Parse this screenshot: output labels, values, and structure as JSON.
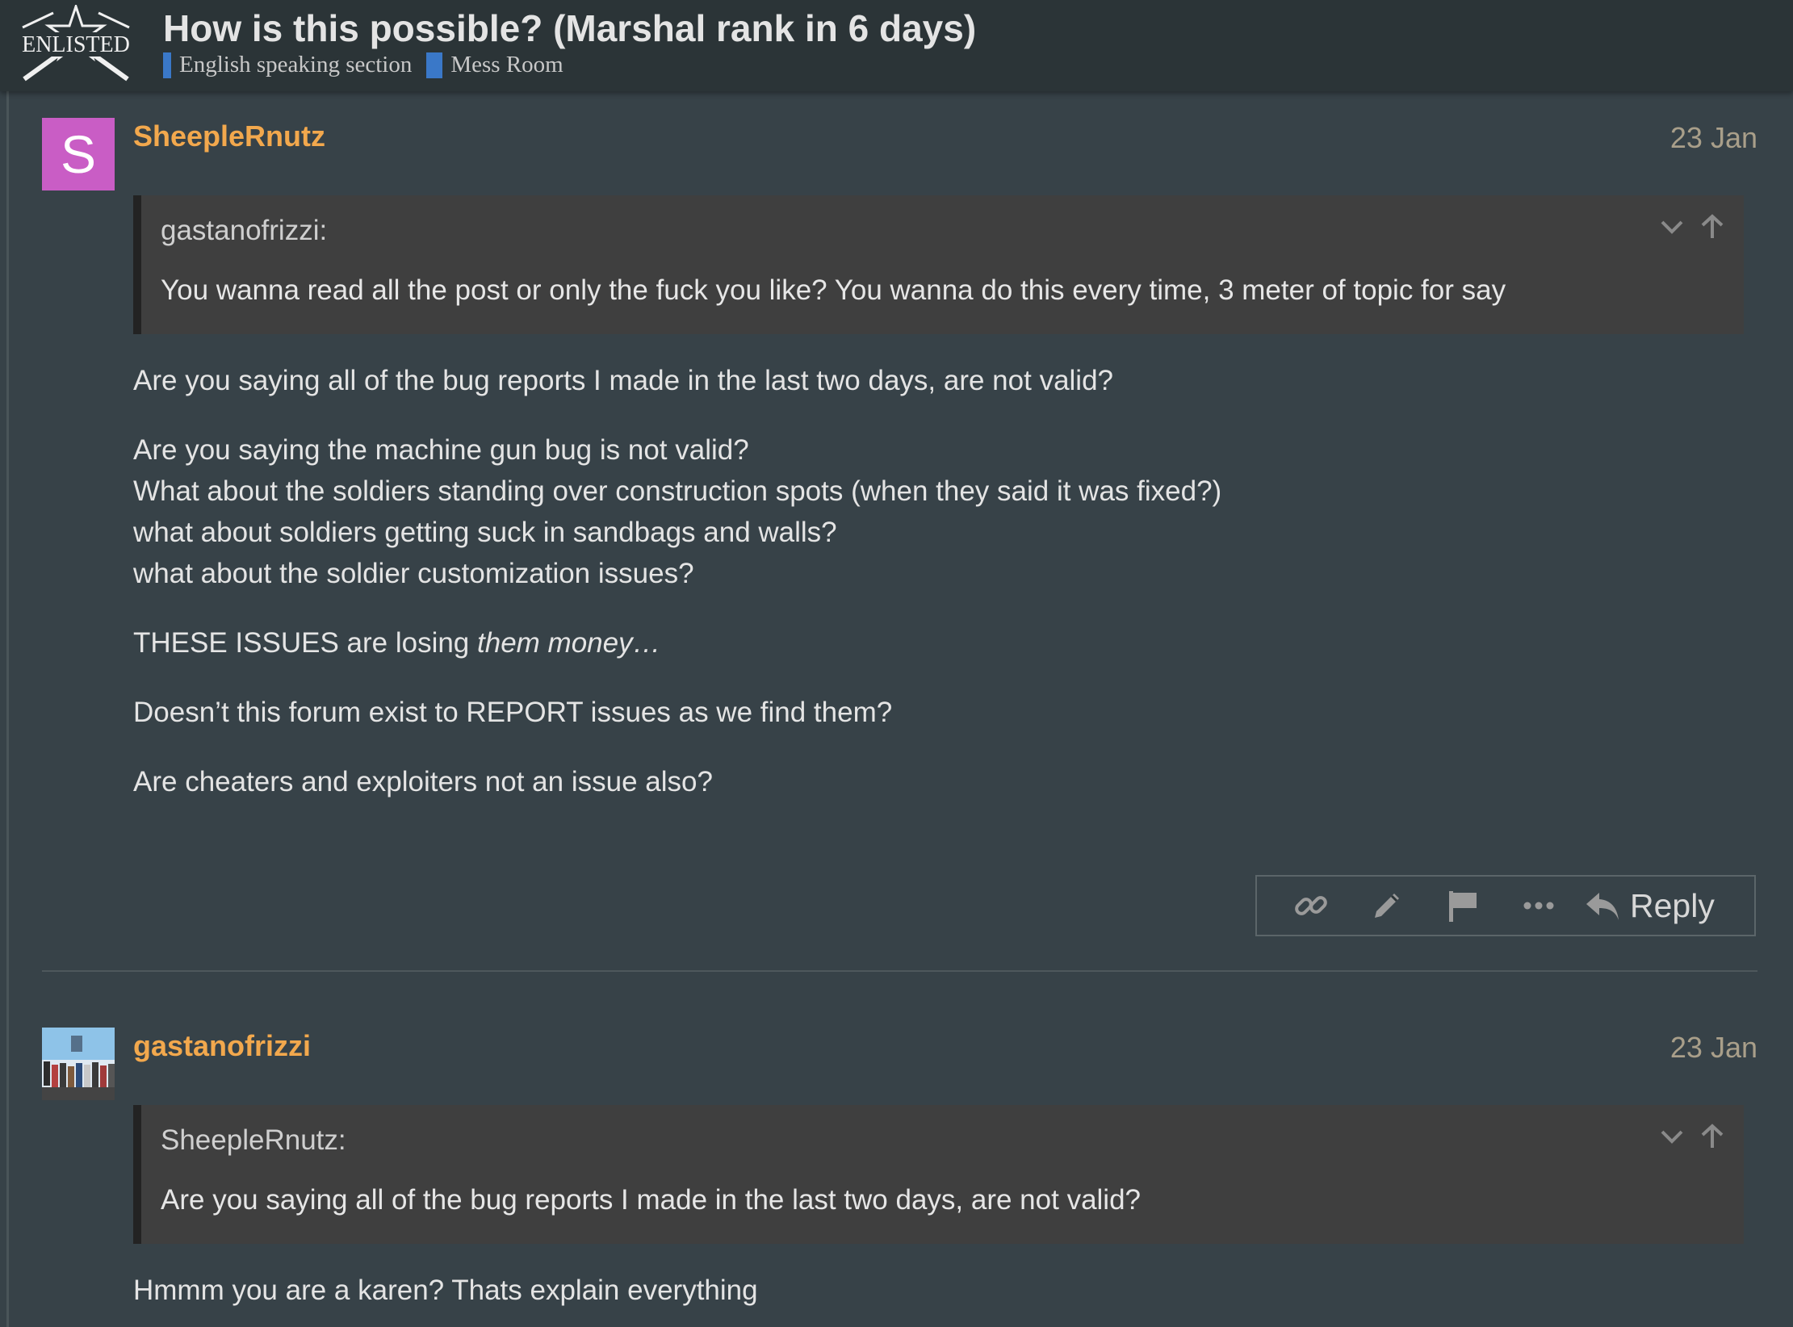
{
  "site": {
    "logo_text": "ENLISTED",
    "logo_icon": "enlisted-star-rifles-logo"
  },
  "topic": {
    "title": "How is this possible? (Marshal rank in 6 days)",
    "categories": [
      {
        "label": "English speaking section",
        "color": "#3a78c8"
      },
      {
        "label": "Mess Room",
        "color": "#3a78c8"
      }
    ]
  },
  "posts": [
    {
      "username": "SheepleRnutz",
      "avatar_letter": "S",
      "avatar_color": "#c95dc5",
      "date": "23 Jan",
      "quote": {
        "author": "gastanofrizzi:",
        "text": "You wanna read all the post or only the fuck you like? You wanna do this every time, 3 meter of topic for say"
      },
      "paragraph_1": "Are you saying all of the bug reports I made in the last two days, are not valid?",
      "paragraph_2_lines": [
        "Are you saying the machine gun bug is not valid?",
        "What about the soldiers standing over construction spots (when they said it was fixed?)",
        "what about soldiers getting suck in sandbags and walls?",
        "what about the soldier customization issues?"
      ],
      "paragraph_3_prefix": "THESE ISSUES are losing ",
      "paragraph_3_italic": "them money…",
      "paragraph_4": "Doesn’t this forum exist to REPORT issues as we find them?",
      "paragraph_5": "Are cheaters and exploiters not an issue also?",
      "actions": {
        "icons": [
          "link-icon",
          "pencil-icon",
          "flag-icon",
          "more-icon"
        ],
        "reply_label": "Reply"
      }
    },
    {
      "username": "gastanofrizzi",
      "avatar_icon": "group-photo-avatar",
      "date": "23 Jan",
      "quote": {
        "author": "SheepleRnutz:",
        "text": "Are you saying all of the bug reports I made in the last two days, are not valid?"
      },
      "paragraph_1": "Hmmm you are a karen? Thats explain everything"
    }
  ],
  "colors": {
    "background": "#374248",
    "header": "#2b3437",
    "username": "#f2a84d",
    "date": "#a99f8a",
    "quote_bg": "#3f3f3f"
  }
}
